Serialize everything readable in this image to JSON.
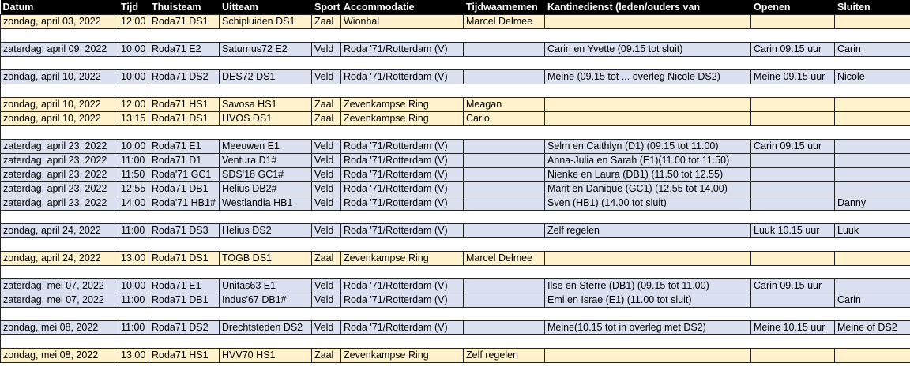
{
  "header": {
    "datum": "Datum",
    "tijd": "Tijd",
    "thuisteam": "Thuisteam",
    "uitteam": "Uitteam",
    "sport": "Sport",
    "accommodatie": "Accommodatie",
    "tijdwaarnemen": "Tijdwaarnemen",
    "kantinedienst": "Kantinedienst (leden/ouders van",
    "openen": "Openen",
    "sluiten": "Sluiten"
  },
  "rows": [
    {
      "type": "zaal",
      "datum": "zondag, april 03, 2022",
      "tijd": "12:00",
      "thuisteam": "Roda71 DS1",
      "uitteam": "Schipluiden DS1",
      "sport": "Zaal",
      "accommodatie": "Wionhal",
      "tijdwaarnemen": "Marcel Delmee",
      "kantinedienst": "",
      "openen": "",
      "sluiten": ""
    },
    {
      "type": "spacer"
    },
    {
      "type": "veld",
      "datum": "zaterdag, april 09, 2022",
      "tijd": "10:00",
      "thuisteam": "Roda71 E2",
      "uitteam": "Saturnus72 E2",
      "sport": "Veld",
      "accommodatie": "Roda '71/Rotterdam (V)",
      "tijdwaarnemen": "",
      "kantinedienst": "Carin en Yvette (09.15 tot sluit)",
      "openen": "Carin 09.15 uur",
      "sluiten": "Carin"
    },
    {
      "type": "spacer"
    },
    {
      "type": "veld",
      "datum": "zondag, april 10, 2022",
      "tijd": "10:00",
      "thuisteam": "Roda71 DS2",
      "uitteam": "DES72 DS1",
      "sport": "Veld",
      "accommodatie": "Roda '71/Rotterdam (V)",
      "tijdwaarnemen": "",
      "kantinedienst": "Meine (09.15 tot ... overleg Nicole DS2)",
      "openen": "Meine 09.15 uur",
      "sluiten": "Nicole"
    },
    {
      "type": "spacer"
    },
    {
      "type": "zaal",
      "datum": "zondag, april 10, 2022",
      "tijd": "12:00",
      "thuisteam": "Roda71 HS1",
      "uitteam": "Savosa HS1",
      "sport": "Zaal",
      "accommodatie": "Zevenkampse Ring",
      "tijdwaarnemen": "Meagan",
      "kantinedienst": "",
      "openen": "",
      "sluiten": ""
    },
    {
      "type": "zaal",
      "datum": "zondag, april 10, 2022",
      "tijd": "13:15",
      "thuisteam": "Roda71 DS1",
      "uitteam": "HVOS DS1",
      "sport": "Zaal",
      "accommodatie": "Zevenkampse Ring",
      "tijdwaarnemen": "Carlo",
      "kantinedienst": "",
      "openen": "",
      "sluiten": ""
    },
    {
      "type": "spacer"
    },
    {
      "type": "veld",
      "datum": "zaterdag, april 23, 2022",
      "tijd": "10:00",
      "thuisteam": "Roda71 E1",
      "uitteam": "Meeuwen E1",
      "sport": "Veld",
      "accommodatie": "Roda '71/Rotterdam (V)",
      "tijdwaarnemen": "",
      "kantinedienst": "Selm en Caithlyn (D1) (09.15 tot 11.00)",
      "openen": "Carin 09.15 uur",
      "sluiten": ""
    },
    {
      "type": "veld",
      "datum": "zaterdag, april 23, 2022",
      "tijd": "11:00",
      "thuisteam": "Roda71 D1",
      "uitteam": "Ventura D1#",
      "sport": "Veld",
      "accommodatie": "Roda '71/Rotterdam (V)",
      "tijdwaarnemen": "",
      "kantinedienst": "Anna-Julia en Sarah (E1)(11.00 tot 11.50)",
      "openen": "",
      "sluiten": ""
    },
    {
      "type": "veld",
      "datum": "zaterdag, april 23, 2022",
      "tijd": "11:50",
      "thuisteam": "Roda'71 GC1",
      "uitteam": "SDS'18 GC1#",
      "sport": "Veld",
      "accommodatie": "Roda '71/Rotterdam (V)",
      "tijdwaarnemen": "",
      "kantinedienst": "Nienke en Laura (DB1) (11.50 tot 12.55)",
      "openen": "",
      "sluiten": ""
    },
    {
      "type": "veld",
      "datum": "zaterdag, april 23, 2022",
      "tijd": "12:55",
      "thuisteam": "Roda71 DB1",
      "uitteam": "Helius DB2#",
      "sport": "Veld",
      "accommodatie": "Roda '71/Rotterdam (V)",
      "tijdwaarnemen": "",
      "kantinedienst": "Marit en Danique (GC1) (12.55 tot 14.00)",
      "openen": "",
      "sluiten": ""
    },
    {
      "type": "veld",
      "datum": "zaterdag, april 23, 2022",
      "tijd": "14:00",
      "thuisteam": "Roda'71 HB1#",
      "uitteam": "Westlandia HB1",
      "sport": "Veld",
      "accommodatie": "Roda '71/Rotterdam (V)",
      "tijdwaarnemen": "",
      "kantinedienst": "Sven (HB1) (14.00 tot sluit)",
      "openen": "",
      "sluiten": "Danny"
    },
    {
      "type": "spacer"
    },
    {
      "type": "veld",
      "datum": "zondag, april 24, 2022",
      "tijd": "11:00",
      "thuisteam": "Roda71 DS3",
      "uitteam": "Helius DS2",
      "sport": "Veld",
      "accommodatie": "Roda '71/Rotterdam (V)",
      "tijdwaarnemen": "",
      "kantinedienst": "Zelf regelen",
      "openen": "Luuk 10.15 uur",
      "sluiten": "Luuk"
    },
    {
      "type": "spacer"
    },
    {
      "type": "zaal",
      "datum": "zondag, april 24, 2022",
      "tijd": "13:00",
      "thuisteam": "Roda71 DS1",
      "uitteam": "TOGB DS1",
      "sport": "Zaal",
      "accommodatie": "Zevenkampse Ring",
      "tijdwaarnemen": "Marcel Delmee",
      "kantinedienst": "",
      "openen": "",
      "sluiten": ""
    },
    {
      "type": "spacer"
    },
    {
      "type": "veld",
      "datum": "zaterdag, mei 07, 2022",
      "tijd": "10:00",
      "thuisteam": "Roda71 E1",
      "uitteam": "Unitas63 E1",
      "sport": "Veld",
      "accommodatie": "Roda '71/Rotterdam (V)",
      "tijdwaarnemen": "",
      "kantinedienst": "Ilse en  Sterre (DB1) (09.15 tot 11.00)",
      "openen": "Carin 09.15 uur",
      "sluiten": ""
    },
    {
      "type": "veld",
      "datum": "zaterdag, mei 07, 2022",
      "tijd": "11:00",
      "thuisteam": "Roda71 DB1",
      "uitteam": "Indus'67 DB1#",
      "sport": "Veld",
      "accommodatie": "Roda '71/Rotterdam (V)",
      "tijdwaarnemen": "",
      "kantinedienst": "Emi en Israe (E1) (11.00 tot sluit)",
      "openen": "",
      "sluiten": "Carin"
    },
    {
      "type": "spacer"
    },
    {
      "type": "veld",
      "datum": "zondag, mei 08, 2022",
      "tijd": "11:00",
      "thuisteam": "Roda71 DS2",
      "uitteam": "Drechtsteden DS2",
      "sport": "Veld",
      "accommodatie": "Roda '71/Rotterdam (V)",
      "tijdwaarnemen": "",
      "kantinedienst": " Meine(10.15 tot in overleg met DS2)",
      "openen": "Meine 10.15 uur",
      "sluiten": "Meine of DS2"
    },
    {
      "type": "spacer"
    },
    {
      "type": "zaal",
      "datum": "zondag, mei 08, 2022",
      "tijd": "13:00",
      "thuisteam": "Roda71 HS1",
      "uitteam": "HVV70 HS1",
      "sport": "Zaal",
      "accommodatie": "Zevenkampse Ring",
      "tijdwaarnemen": "Zelf regelen",
      "kantinedienst": "",
      "openen": "",
      "sluiten": ""
    }
  ]
}
